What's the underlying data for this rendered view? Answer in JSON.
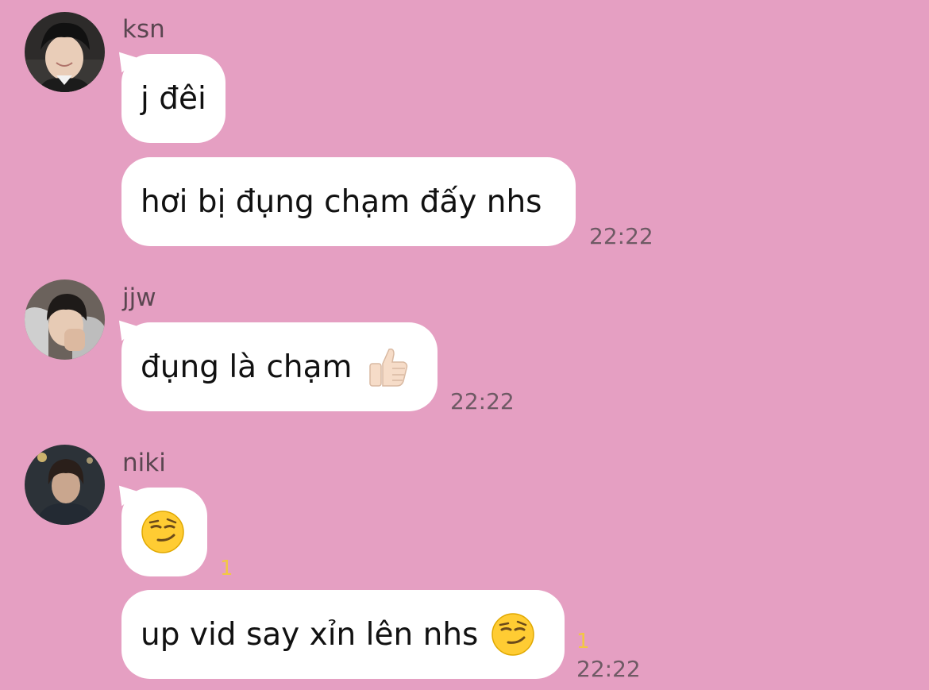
{
  "theme": {
    "background": "#e59fc2",
    "bubble": "#ffffff",
    "unread_color": "#f2c744",
    "time_color": "#6e5a64"
  },
  "messages": [
    {
      "sender": "ksn",
      "avatar": "ksn-avatar",
      "bubbles": [
        {
          "text": "j đêi"
        },
        {
          "text": "hơi bị đụng chạm đấy nhs",
          "time": "22:22"
        }
      ]
    },
    {
      "sender": "jjw",
      "avatar": "jjw-avatar",
      "bubbles": [
        {
          "text": "đụng là chạm",
          "emoji": "thumbs-up-icon",
          "time": "22:22"
        }
      ]
    },
    {
      "sender": "niki",
      "avatar": "niki-avatar",
      "bubbles": [
        {
          "emoji": "smirk-face-icon",
          "unread": "1"
        },
        {
          "text": "up vid say xỉn lên nhs",
          "emoji": "smirk-face-icon",
          "unread": "1",
          "time": "22:22"
        }
      ]
    }
  ]
}
